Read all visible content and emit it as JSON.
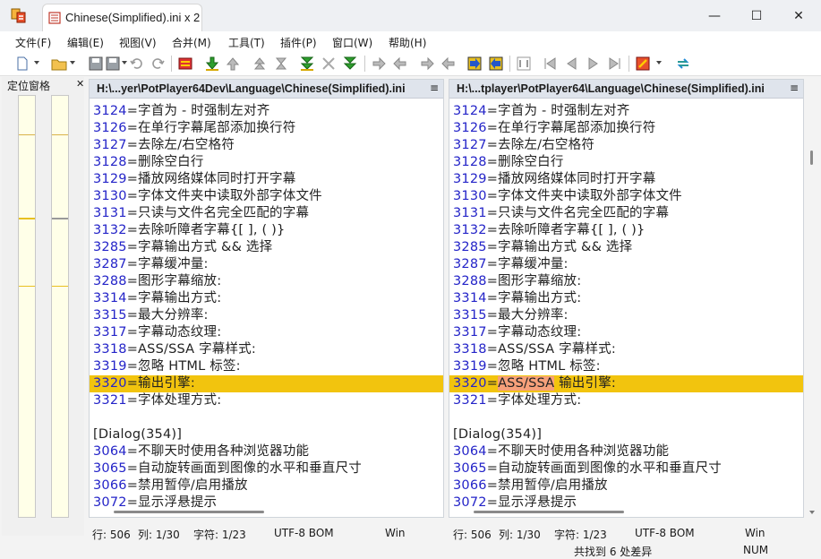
{
  "window": {
    "tab_title": "Chinese(Simplified).ini x 2",
    "controls": {
      "minimize": "—",
      "maximize": "☐",
      "close": "✕"
    }
  },
  "menu": [
    "文件(F)",
    "编辑(E)",
    "视图(V)",
    "合并(M)",
    "工具(T)",
    "插件(P)",
    "窗口(W)",
    "帮助(H)"
  ],
  "location_pane": {
    "title": "定位窗格",
    "close": "✕"
  },
  "left_pane": {
    "path": "H:\\...yer\\PotPlayer64Dev\\Language\\Chinese(Simplified).ini",
    "menu_icon": "≡",
    "lines": [
      {
        "num": "3124",
        "text": "=字首为 - 时强制左对齐"
      },
      {
        "num": "3126",
        "text": "=在单行字幕尾部添加换行符"
      },
      {
        "num": "3127",
        "text": "=去除左/右空格符"
      },
      {
        "num": "3128",
        "text": "=删除空白行"
      },
      {
        "num": "3129",
        "text": "=播放网络媒体同时打开字幕"
      },
      {
        "num": "3130",
        "text": "=字体文件夹中读取外部字体文件"
      },
      {
        "num": "3131",
        "text": "=只读与文件名完全匹配的字幕"
      },
      {
        "num": "3132",
        "text": "=去除听障者字幕{[ ], ( )}"
      },
      {
        "num": "3285",
        "text": "=字幕输出方式 && 选择"
      },
      {
        "num": "3287",
        "text": "=字幕缓冲量:"
      },
      {
        "num": "3288",
        "text": "=图形字幕缩放:"
      },
      {
        "num": "3314",
        "text": "=字幕输出方式:"
      },
      {
        "num": "3315",
        "text": "=最大分辨率:"
      },
      {
        "num": "3317",
        "text": "=字幕动态纹理:"
      },
      {
        "num": "3318",
        "text": "=ASS/SSA 字幕样式:"
      },
      {
        "num": "3319",
        "text": "=忽略 HTML 标签:"
      },
      {
        "num": "3320",
        "text": "=输出引擎:"
      },
      {
        "num": "3321",
        "text": "=字体处理方式:"
      },
      {
        "num": "",
        "text": ""
      },
      {
        "num": "",
        "text": "[Dialog(354)]"
      },
      {
        "num": "3064",
        "text": "=不聊天时使用各种浏览器功能"
      },
      {
        "num": "3065",
        "text": "=自动旋转画面到图像的水平和垂直尺寸"
      },
      {
        "num": "3066",
        "text": "=禁用暂停/启用播放"
      },
      {
        "num": "3072",
        "text": "=显示浮悬提示"
      }
    ],
    "status": {
      "line": "行: 506",
      "col": "列: 1/30",
      "char": "字符: 1/23",
      "encoding": "UTF-8 BOM",
      "eol": "Win"
    }
  },
  "right_pane": {
    "path": "H:\\...tplayer\\PotPlayer64\\Language\\Chinese(Simplified).ini",
    "menu_icon": "≡",
    "lines": [
      {
        "num": "3124",
        "text": "=字首为 - 时强制左对齐"
      },
      {
        "num": "3126",
        "text": "=在单行字幕尾部添加换行符"
      },
      {
        "num": "3127",
        "text": "=去除左/右空格符"
      },
      {
        "num": "3128",
        "text": "=删除空白行"
      },
      {
        "num": "3129",
        "text": "=播放网络媒体同时打开字幕"
      },
      {
        "num": "3130",
        "text": "=字体文件夹中读取外部字体文件"
      },
      {
        "num": "3131",
        "text": "=只读与文件名完全匹配的字幕"
      },
      {
        "num": "3132",
        "text": "=去除听障者字幕{[ ], ( )}"
      },
      {
        "num": "3285",
        "text": "=字幕输出方式 && 选择"
      },
      {
        "num": "3287",
        "text": "=字幕缓冲量:"
      },
      {
        "num": "3288",
        "text": "=图形字幕缩放:"
      },
      {
        "num": "3314",
        "text": "=字幕输出方式:"
      },
      {
        "num": "3315",
        "text": "=最大分辨率:"
      },
      {
        "num": "3317",
        "text": "=字幕动态纹理:"
      },
      {
        "num": "3318",
        "text": "=ASS/SSA 字幕样式:"
      },
      {
        "num": "3319",
        "text": "=忽略 HTML 标签:"
      },
      {
        "num": "3320",
        "text": "=ASS/SSA 输出引擎:"
      },
      {
        "num": "3321",
        "text": "=字体处理方式:"
      },
      {
        "num": "",
        "text": ""
      },
      {
        "num": "",
        "text": "[Dialog(354)]"
      },
      {
        "num": "3064",
        "text": "=不聊天时使用各种浏览器功能"
      },
      {
        "num": "3065",
        "text": "=自动旋转画面到图像的水平和垂直尺寸"
      },
      {
        "num": "3066",
        "text": "=禁用暂停/启用播放"
      },
      {
        "num": "3072",
        "text": "=显示浮悬提示"
      }
    ],
    "status": {
      "line": "行: 506",
      "col": "列: 1/30",
      "char": "字符: 1/23",
      "encoding": "UTF-8 BOM",
      "eol": "Win"
    }
  },
  "diff_summary": "共找到 6 处差异",
  "num_indicator": "NUM",
  "colors": {
    "line_number": "#2424c8",
    "diff_highlight": "#f2c40e",
    "diff_segment": "#f6a07a",
    "section": "#a0285a"
  }
}
